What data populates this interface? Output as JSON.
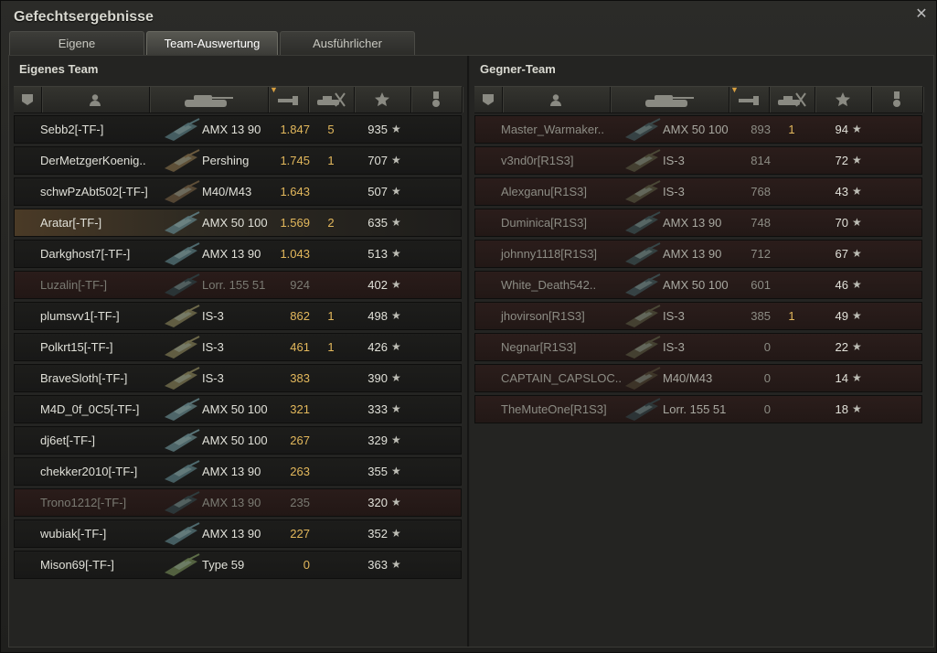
{
  "window": {
    "title": "Gefechtsergebnisse"
  },
  "tabs": [
    {
      "label": "Eigene Auswertung"
    },
    {
      "label": "Team-Auswertung"
    },
    {
      "label": "Ausführlicher Bericht"
    }
  ],
  "active_tab": "Team-Auswertung",
  "icons": {
    "header": [
      "rank-icon",
      "player-icon",
      "tank-icon",
      "damage-icon",
      "frags-icon",
      "xp-icon",
      "medal-icon"
    ],
    "row": [
      "tank-icon",
      "star-icon"
    ],
    "window": [
      "close-icon"
    ]
  },
  "sort_column": "damage",
  "own_team": {
    "title": "Eigenes Team",
    "rows": [
      {
        "name": "Sebb2[-TF-]",
        "tank": "AMX 13 90",
        "damage": "1.847",
        "frags": "5",
        "xp": "935",
        "state": "alive",
        "tank_color": "#4e6a6e"
      },
      {
        "name": "DerMetzgerKoenig..",
        "tank": "Pershing",
        "damage": "1.745",
        "frags": "1",
        "xp": "707",
        "state": "alive",
        "tank_color": "#6b5a3e"
      },
      {
        "name": "schwPzAbt502[-TF-]",
        "tank": "M40/M43",
        "damage": "1.643",
        "frags": "",
        "xp": "507",
        "state": "alive",
        "tank_color": "#5e4e38"
      },
      {
        "name": "Aratar[-TF-]",
        "tank": "AMX 50 100",
        "damage": "1.569",
        "frags": "2",
        "xp": "635",
        "state": "self",
        "tank_color": "#587478"
      },
      {
        "name": "Darkghost7[-TF-]",
        "tank": "AMX 13 90",
        "damage": "1.043",
        "frags": "",
        "xp": "513",
        "state": "alive",
        "tank_color": "#4e6a6e"
      },
      {
        "name": "Luzalin[-TF-]",
        "tank": "Lorr. 155 51",
        "damage": "924",
        "frags": "",
        "xp": "402",
        "state": "dead",
        "tank_color": "#2c3a3c"
      },
      {
        "name": "plumsvv1[-TF-]",
        "tank": "IS-3",
        "damage": "862",
        "frags": "1",
        "xp": "498",
        "state": "alive",
        "tank_color": "#6e6a4a"
      },
      {
        "name": "Polkrt15[-TF-]",
        "tank": "IS-3",
        "damage": "461",
        "frags": "1",
        "xp": "426",
        "state": "alive",
        "tank_color": "#6e6a4a"
      },
      {
        "name": "BraveSloth[-TF-]",
        "tank": "IS-3",
        "damage": "383",
        "frags": "",
        "xp": "390",
        "state": "alive",
        "tank_color": "#6e6a4a"
      },
      {
        "name": "M4D_0f_0C5[-TF-]",
        "tank": "AMX 50 100",
        "damage": "321",
        "frags": "",
        "xp": "333",
        "state": "alive",
        "tank_color": "#587478"
      },
      {
        "name": "dj6et[-TF-]",
        "tank": "AMX 50 100",
        "damage": "267",
        "frags": "",
        "xp": "329",
        "state": "alive",
        "tank_color": "#587478"
      },
      {
        "name": "chekker2010[-TF-]",
        "tank": "AMX 13 90",
        "damage": "263",
        "frags": "",
        "xp": "355",
        "state": "alive",
        "tank_color": "#4e6a6e"
      },
      {
        "name": "Trono1212[-TF-]",
        "tank": "AMX 13 90",
        "damage": "235",
        "frags": "",
        "xp": "320",
        "state": "dead",
        "tank_color": "#2e3c3e"
      },
      {
        "name": "wubiak[-TF-]",
        "tank": "AMX 13 90",
        "damage": "227",
        "frags": "",
        "xp": "352",
        "state": "alive",
        "tank_color": "#4e6a6e"
      },
      {
        "name": "Mison69[-TF-]",
        "tank": "Type 59",
        "damage": "0",
        "frags": "",
        "xp": "363",
        "state": "alive",
        "tank_color": "#5e6e48"
      }
    ]
  },
  "enemy_team": {
    "title": "Gegner-Team",
    "rows": [
      {
        "name": "Master_Warmaker..",
        "tank": "AMX 50 100",
        "damage": "893",
        "frags": "1",
        "xp": "94",
        "state": "enemy",
        "tank_color": "#3a4a4c"
      },
      {
        "name": "v3nd0r[R1S3]",
        "tank": "IS-3",
        "damage": "814",
        "frags": "",
        "xp": "72",
        "state": "enemy",
        "tank_color": "#4a4836"
      },
      {
        "name": "Alexganu[R1S3]",
        "tank": "IS-3",
        "damage": "768",
        "frags": "",
        "xp": "43",
        "state": "enemy",
        "tank_color": "#4a4836"
      },
      {
        "name": "Duminica[R1S3]",
        "tank": "AMX 13 90",
        "damage": "748",
        "frags": "",
        "xp": "70",
        "state": "enemy",
        "tank_color": "#364648"
      },
      {
        "name": "johnny1118[R1S3]",
        "tank": "AMX 13 90",
        "damage": "712",
        "frags": "",
        "xp": "67",
        "state": "enemy",
        "tank_color": "#364648"
      },
      {
        "name": "White_Death542..",
        "tank": "AMX 50 100",
        "damage": "601",
        "frags": "",
        "xp": "46",
        "state": "enemy",
        "tank_color": "#3a4a4c"
      },
      {
        "name": "jhovirson[R1S3]",
        "tank": "IS-3",
        "damage": "385",
        "frags": "1",
        "xp": "49",
        "state": "enemy",
        "tank_color": "#4a4836"
      },
      {
        "name": "Negnar[R1S3]",
        "tank": "IS-3",
        "damage": "0",
        "frags": "",
        "xp": "22",
        "state": "enemy",
        "tank_color": "#4a4836"
      },
      {
        "name": "CAPTAIN_CAPSLOC..",
        "tank": "M40/M43",
        "damage": "0",
        "frags": "",
        "xp": "14",
        "state": "enemy",
        "tank_color": "#42392c"
      },
      {
        "name": "TheMuteOne[R1S3]",
        "tank": "Lorr. 155 51",
        "damage": "0",
        "frags": "",
        "xp": "18",
        "state": "enemy",
        "tank_color": "#2e3a3c"
      }
    ]
  }
}
